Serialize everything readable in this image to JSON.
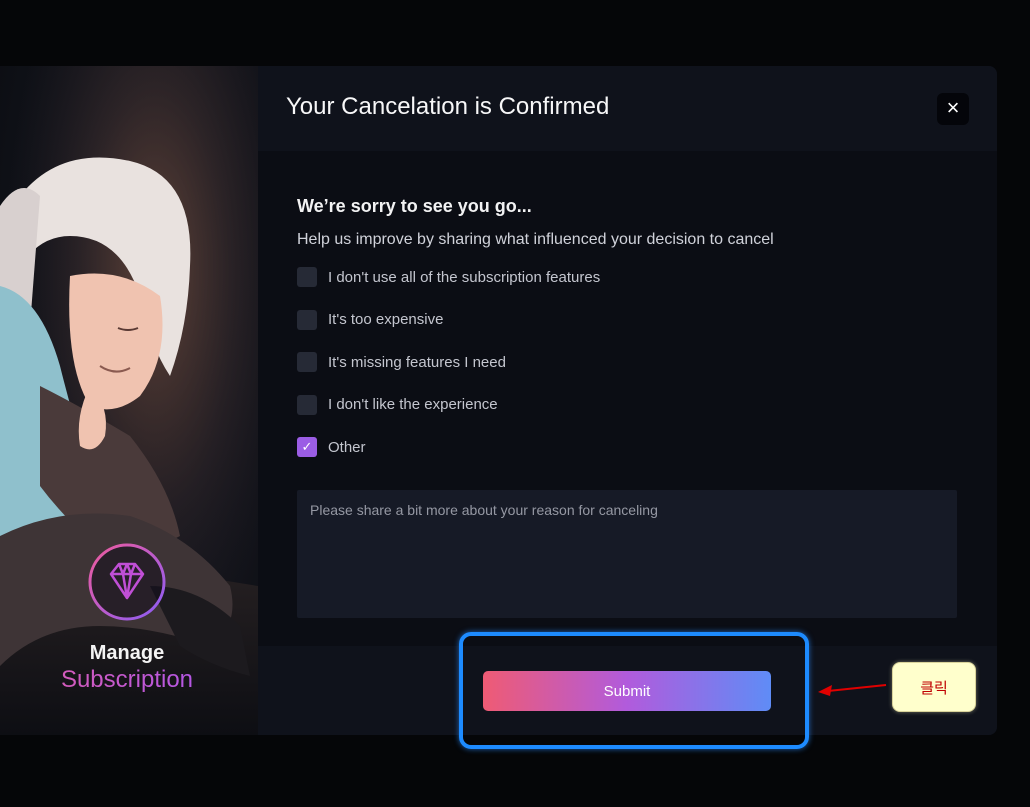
{
  "side_panel": {
    "brand_line1": "Manage",
    "brand_line2": "Subscription",
    "logo_icon": "diamond-icon"
  },
  "modal": {
    "title": "Your Cancelation is Confirmed",
    "close_icon": "close-icon",
    "close_symbol": "×",
    "heading": "We’re sorry to see you go...",
    "subheading": "Help us improve by sharing what influenced your decision to cancel",
    "reasons": [
      {
        "label": "I don't use all of the subscription features",
        "checked": false
      },
      {
        "label": "It's too expensive",
        "checked": false
      },
      {
        "label": "It's missing features I need",
        "checked": false
      },
      {
        "label": "I don't like the experience",
        "checked": false
      },
      {
        "label": "Other",
        "checked": true
      }
    ],
    "check_mark": "✓",
    "textarea_placeholder": "Please share a bit more about your reason for canceling",
    "submit_label": "Submit"
  },
  "annotation": {
    "callout_text": "클릭",
    "highlight_color": "#1d8bff",
    "arrow_color": "#e00000"
  },
  "colors": {
    "accent_gradient_start": "#ef5b74",
    "accent_gradient_mid": "#b15bdc",
    "accent_gradient_end": "#5f8cf6",
    "checkbox_checked": "#9b5de5"
  }
}
